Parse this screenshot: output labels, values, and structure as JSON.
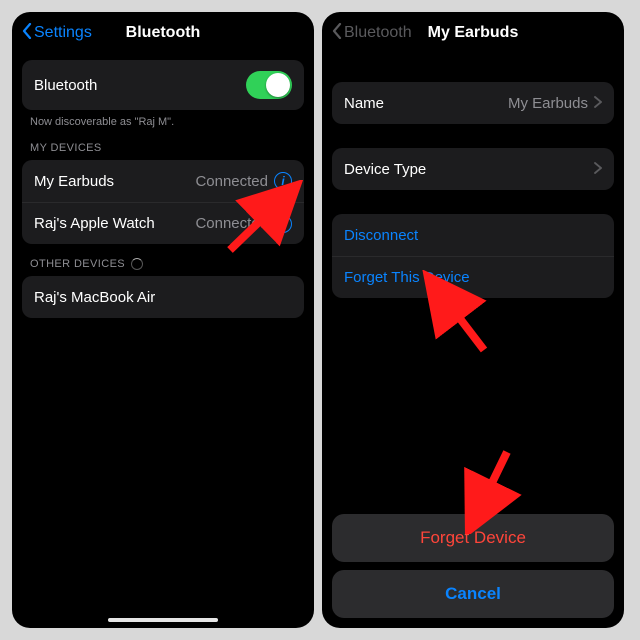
{
  "left": {
    "nav": {
      "back": "Settings",
      "title": "Bluetooth"
    },
    "toggle_row": {
      "label": "Bluetooth"
    },
    "discoverable": "Now discoverable as \"Raj M\".",
    "my_devices_header": "MY DEVICES",
    "devices": [
      {
        "name": "My Earbuds",
        "status": "Connected"
      },
      {
        "name": "Raj's Apple Watch",
        "status": "Connected"
      }
    ],
    "other_devices_header": "OTHER DEVICES",
    "other": [
      {
        "name": "Raj's MacBook Air"
      }
    ]
  },
  "right": {
    "nav": {
      "back": "Bluetooth",
      "title": "My Earbuds"
    },
    "name_row": {
      "label": "Name",
      "value": "My Earbuds"
    },
    "type_row": {
      "label": "Device Type"
    },
    "disconnect": "Disconnect",
    "forget": "Forget This Device",
    "sheet": {
      "forget": "Forget Device",
      "cancel": "Cancel"
    }
  }
}
